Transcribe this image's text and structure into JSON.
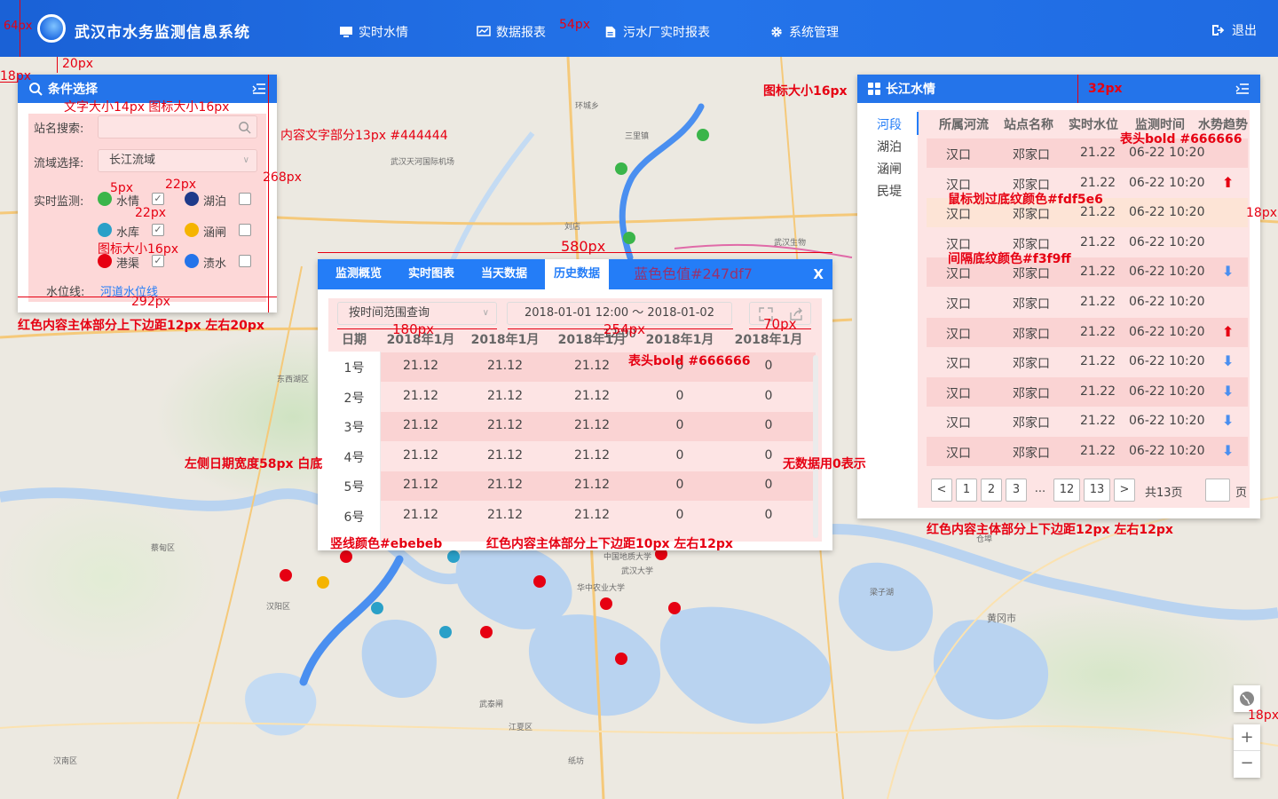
{
  "header": {
    "title": "武汉市水务监测信息系统",
    "nav": [
      "实时水情",
      "数据报表",
      "污水厂实时报表",
      "系统管理"
    ],
    "logout": "退出"
  },
  "map_labels": [
    "三里镇",
    "环城乡",
    "武汉天河国际机场",
    "刘店",
    "武汉生物",
    "东西湖区",
    "江夏区",
    "黄冈市",
    "汉阳区",
    "武汉大学",
    "华中农业大学",
    "中国地质大学",
    "梁子湖",
    "武泰闸",
    "汉南区",
    "阳逻",
    "仓埠",
    "蔡甸区",
    "纸坊"
  ],
  "condition_panel": {
    "title": "条件选择",
    "search_label": "站名搜索:",
    "search_placeholder": "",
    "basin_label": "流域选择:",
    "basin_value": "长江流域",
    "monitor_label": "实时监测:",
    "monitors": [
      {
        "label": "水情",
        "checked": true
      },
      {
        "label": "湖泊",
        "checked": false
      },
      {
        "label": "水库",
        "checked": true
      },
      {
        "label": "涵闸",
        "checked": false
      },
      {
        "label": "港渠",
        "checked": true
      },
      {
        "label": "渍水",
        "checked": false
      }
    ],
    "level_label": "水位线:",
    "level_link": "河道水位线"
  },
  "detail_panel": {
    "tabs": [
      "监测概览",
      "实时图表",
      "当天数据",
      "历史数据"
    ],
    "active_tab": "历史数据",
    "tab_note": "蓝色色值#247df7",
    "close": "X",
    "query_select": "按时间范围查询",
    "date_range": "2018-01-01 12:00 ～ 2018-01-02 12:00",
    "columns": [
      "日期",
      "2018年1月",
      "2018年1月",
      "2018年1月",
      "2018年1月",
      "2018年1月"
    ],
    "rows": [
      [
        "1号",
        "21.12",
        "21.12",
        "21.12",
        "0",
        "0"
      ],
      [
        "2号",
        "21.12",
        "21.12",
        "21.12",
        "0",
        "0"
      ],
      [
        "3号",
        "21.12",
        "21.12",
        "21.12",
        "0",
        "0"
      ],
      [
        "4号",
        "21.12",
        "21.12",
        "21.12",
        "0",
        "0"
      ],
      [
        "5号",
        "21.12",
        "21.12",
        "21.12",
        "0",
        "0"
      ],
      [
        "6号",
        "21.12",
        "21.12",
        "21.12",
        "0",
        "0"
      ]
    ]
  },
  "river_panel": {
    "title": "长江水情",
    "tabs": [
      "河段",
      "湖泊",
      "涵闸",
      "民堤"
    ],
    "active_tab": "河段",
    "columns": [
      "所属河流",
      "站点名称",
      "实时水位",
      "监测时间",
      "水势趋势"
    ],
    "rows": [
      {
        "river": "汉口",
        "station": "邓家口",
        "level": "21.22",
        "time": "06-22 10:20",
        "trend": ""
      },
      {
        "river": "汉口",
        "station": "邓家口",
        "level": "21.22",
        "time": "06-22 10:20",
        "trend": "up"
      },
      {
        "river": "汉口",
        "station": "邓家口",
        "level": "21.22",
        "time": "06-22 10:20",
        "trend": ""
      },
      {
        "river": "汉口",
        "station": "邓家口",
        "level": "21.22",
        "time": "06-22 10:20",
        "trend": ""
      },
      {
        "river": "汉口",
        "station": "邓家口",
        "level": "21.22",
        "time": "06-22 10:20",
        "trend": "down"
      },
      {
        "river": "汉口",
        "station": "邓家口",
        "level": "21.22",
        "time": "06-22 10:20",
        "trend": ""
      },
      {
        "river": "汉口",
        "station": "邓家口",
        "level": "21.22",
        "time": "06-22 10:20",
        "trend": "up"
      },
      {
        "river": "汉口",
        "station": "邓家口",
        "level": "21.22",
        "time": "06-22 10:20",
        "trend": "down"
      },
      {
        "river": "汉口",
        "station": "邓家口",
        "level": "21.22",
        "time": "06-22 10:20",
        "trend": "down"
      },
      {
        "river": "汉口",
        "station": "邓家口",
        "level": "21.22",
        "time": "06-22 10:20",
        "trend": "down"
      },
      {
        "river": "汉口",
        "station": "邓家口",
        "level": "21.22",
        "time": "06-22 10:20",
        "trend": "down"
      }
    ],
    "pagination": {
      "prev": "<",
      "pages": [
        "1",
        "2",
        "3",
        "...",
        "12",
        "13"
      ],
      "next": ">",
      "total": "共13页",
      "page_suffix": "页"
    }
  },
  "map_controls": {
    "zoom_in": "+",
    "zoom_out": "−"
  },
  "annotations": {
    "a_64px": "64px",
    "a_20px": "20px",
    "a_18px": "18px",
    "a_font": "文字大小14px  图标大小16px",
    "a_268": "268px",
    "a_content": "内容文字部分13px #444444",
    "a_5px": "5px",
    "a_22px_a": "22px",
    "a_22px_b": "22px",
    "a_icon16_l": "图标大小16px",
    "a_292": "292px",
    "a_red_left": "红色内容主体部分上下边距12px  左右20px",
    "a_icon16_r": "图标大小16px",
    "a_32px": "32px",
    "a_head_r": "表头bold #666666",
    "a_hover": "鼠标划过底纹颜色#fdf5e6",
    "a_18px_r": "18px",
    "a_stripe": "间隔底纹颜色#f3f9ff",
    "a_54px": "54px",
    "a_580": "580px",
    "a_180": "180px",
    "a_254": "254px",
    "a_70": "70px",
    "a_head_c": "表头bold #666666",
    "a_date_w": "左侧日期宽度58px  白底",
    "a_nodata": "无数据用0表示",
    "a_vline": "竖线颜色#ebebeb",
    "a_red_center": "红色内容主体部分上下边距10px  左右12px",
    "a_red_right": "红色内容主体部分上下边距12px  左右12px",
    "a_18px_b": "18px"
  },
  "colors": {
    "primary": "#247df7",
    "header_text": "#666666",
    "content_text": "#444444",
    "hover_row": "#fdf5e6",
    "stripe_row": "#f3f9ff",
    "vline": "#ebebeb",
    "annotation": "#e60012"
  }
}
